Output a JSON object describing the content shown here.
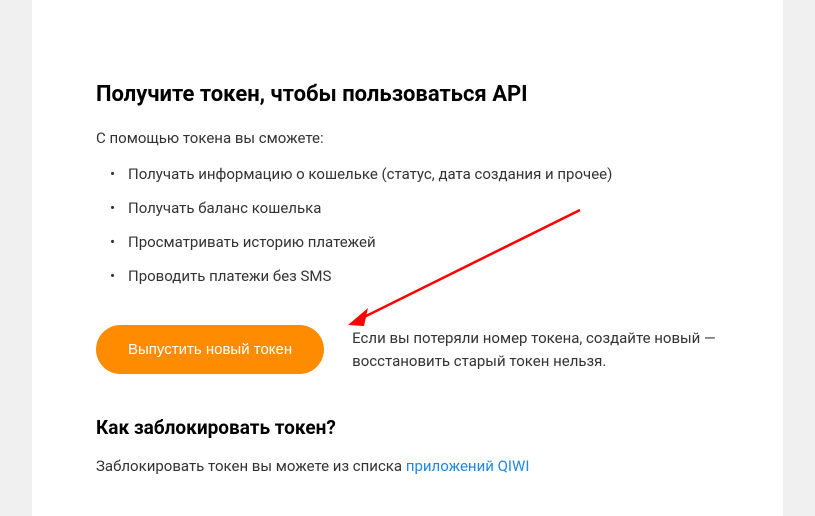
{
  "main": {
    "heading": "Получите токен, чтобы пользоваться API",
    "intro": "С помощью токена вы сможете:",
    "bullets": [
      "Получать информацию о кошельке (статус, дата создания и прочее)",
      "Получать баланс кошелька",
      "Просматривать историю платежей",
      "Проводить платежи без SMS"
    ],
    "button_label": "Выпустить новый токен",
    "note": "Если вы потеряли номер токена, создайте новый — восстановить старый токен нельзя."
  },
  "block": {
    "heading": "Как заблокировать токен?",
    "text_prefix": "Заблокировать токен вы можете из списка ",
    "link_text": "приложений QIWI"
  }
}
